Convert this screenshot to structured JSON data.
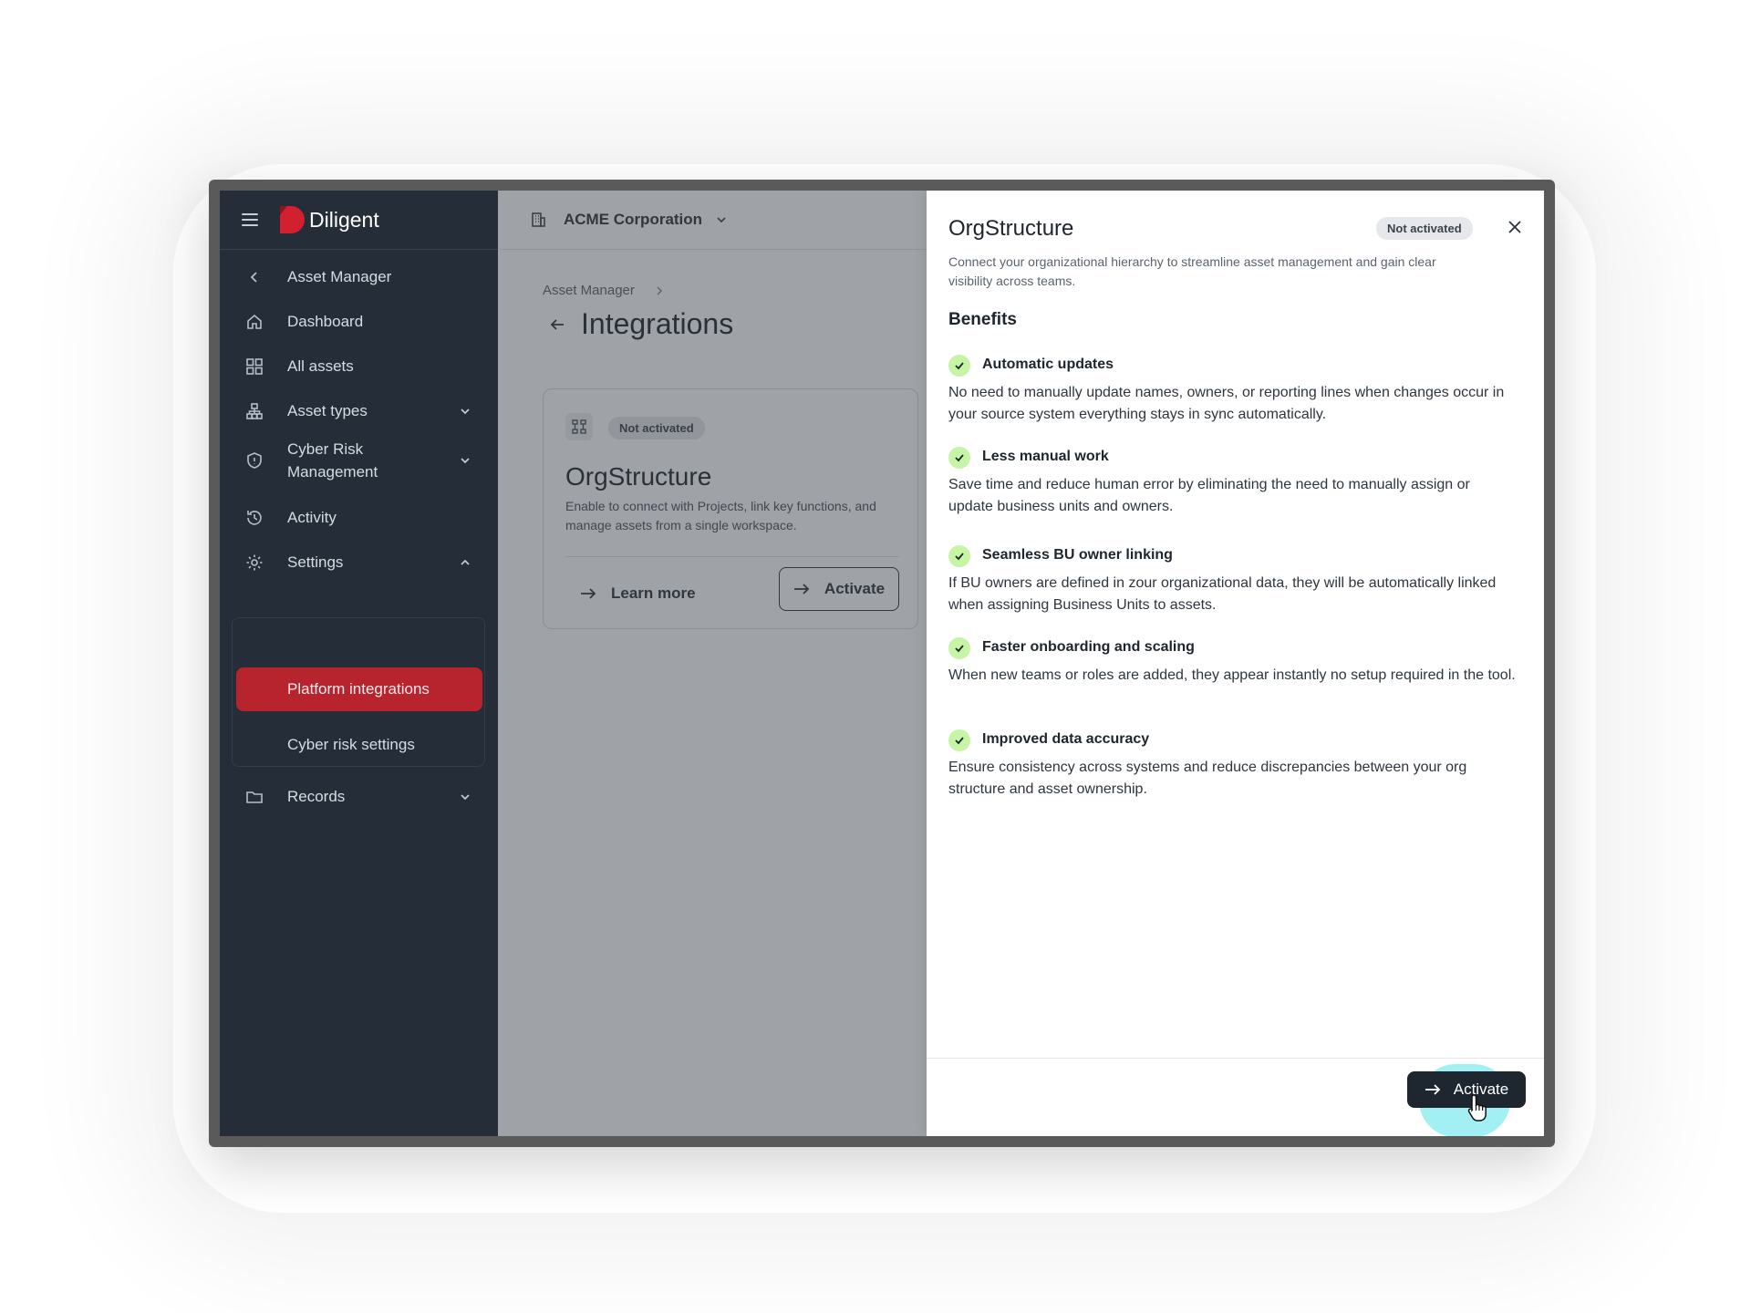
{
  "app": {
    "brand": "Diligent",
    "brand_color": "#d3202f",
    "sidebar_bg": "#252d38",
    "accent_active": "#b8242e"
  },
  "sidebar": {
    "back_label": "Asset Manager",
    "items": [
      {
        "label": "Dashboard",
        "icon": "home-icon"
      },
      {
        "label": "All assets",
        "icon": "grid-icon"
      },
      {
        "label": "Asset types",
        "icon": "hierarchy-icon"
      },
      {
        "label": "Cyber Risk\nManagement",
        "icon": "shield-icon"
      },
      {
        "label": "Activity",
        "icon": "history-icon"
      },
      {
        "label": "Settings",
        "icon": "gear-icon"
      },
      {
        "label": "Records",
        "icon": "folder-icon"
      }
    ],
    "settings_sub": [
      "Platform integrations",
      "Cyber risk settings"
    ]
  },
  "topbar": {
    "org_name": "ACME Corporation"
  },
  "page": {
    "breadcrumb": "Asset Manager",
    "title": "Integrations"
  },
  "card": {
    "badge": "Not activated",
    "title": "OrgStructure",
    "description": "Enable to connect with Projects, link key functions, and manage assets from a single workspace.",
    "learn_more": "Learn more",
    "activate": "Activate"
  },
  "drawer": {
    "title": "OrgStructure",
    "badge": "Not activated",
    "description": "Connect your organizational hierarchy to streamline asset management and gain clear visibility across teams.",
    "benefits_heading": "Benefits",
    "benefits": [
      {
        "title": "Automatic updates",
        "text": "No need to manually update names, owners, or reporting lines when changes occur in your source system  everything stays in sync automatically."
      },
      {
        "title": "Less manual work",
        "text": "Save time and reduce human error by eliminating the need to manually assign or update business units and owners."
      },
      {
        "title": "Seamless BU owner linking",
        "text": "If BU owners are defined in zour organizational data, they will be automatically linked when assigning Business Units to assets."
      },
      {
        "title": "Faster onboarding and scaling",
        "text": "When new teams or roles are added, they appear instantly no setup required in the tool."
      },
      {
        "title": "Improved data accuracy",
        "text": "Ensure consistency across systems and reduce discrepancies between your org structure and asset ownership."
      }
    ],
    "activate": "Activate"
  }
}
